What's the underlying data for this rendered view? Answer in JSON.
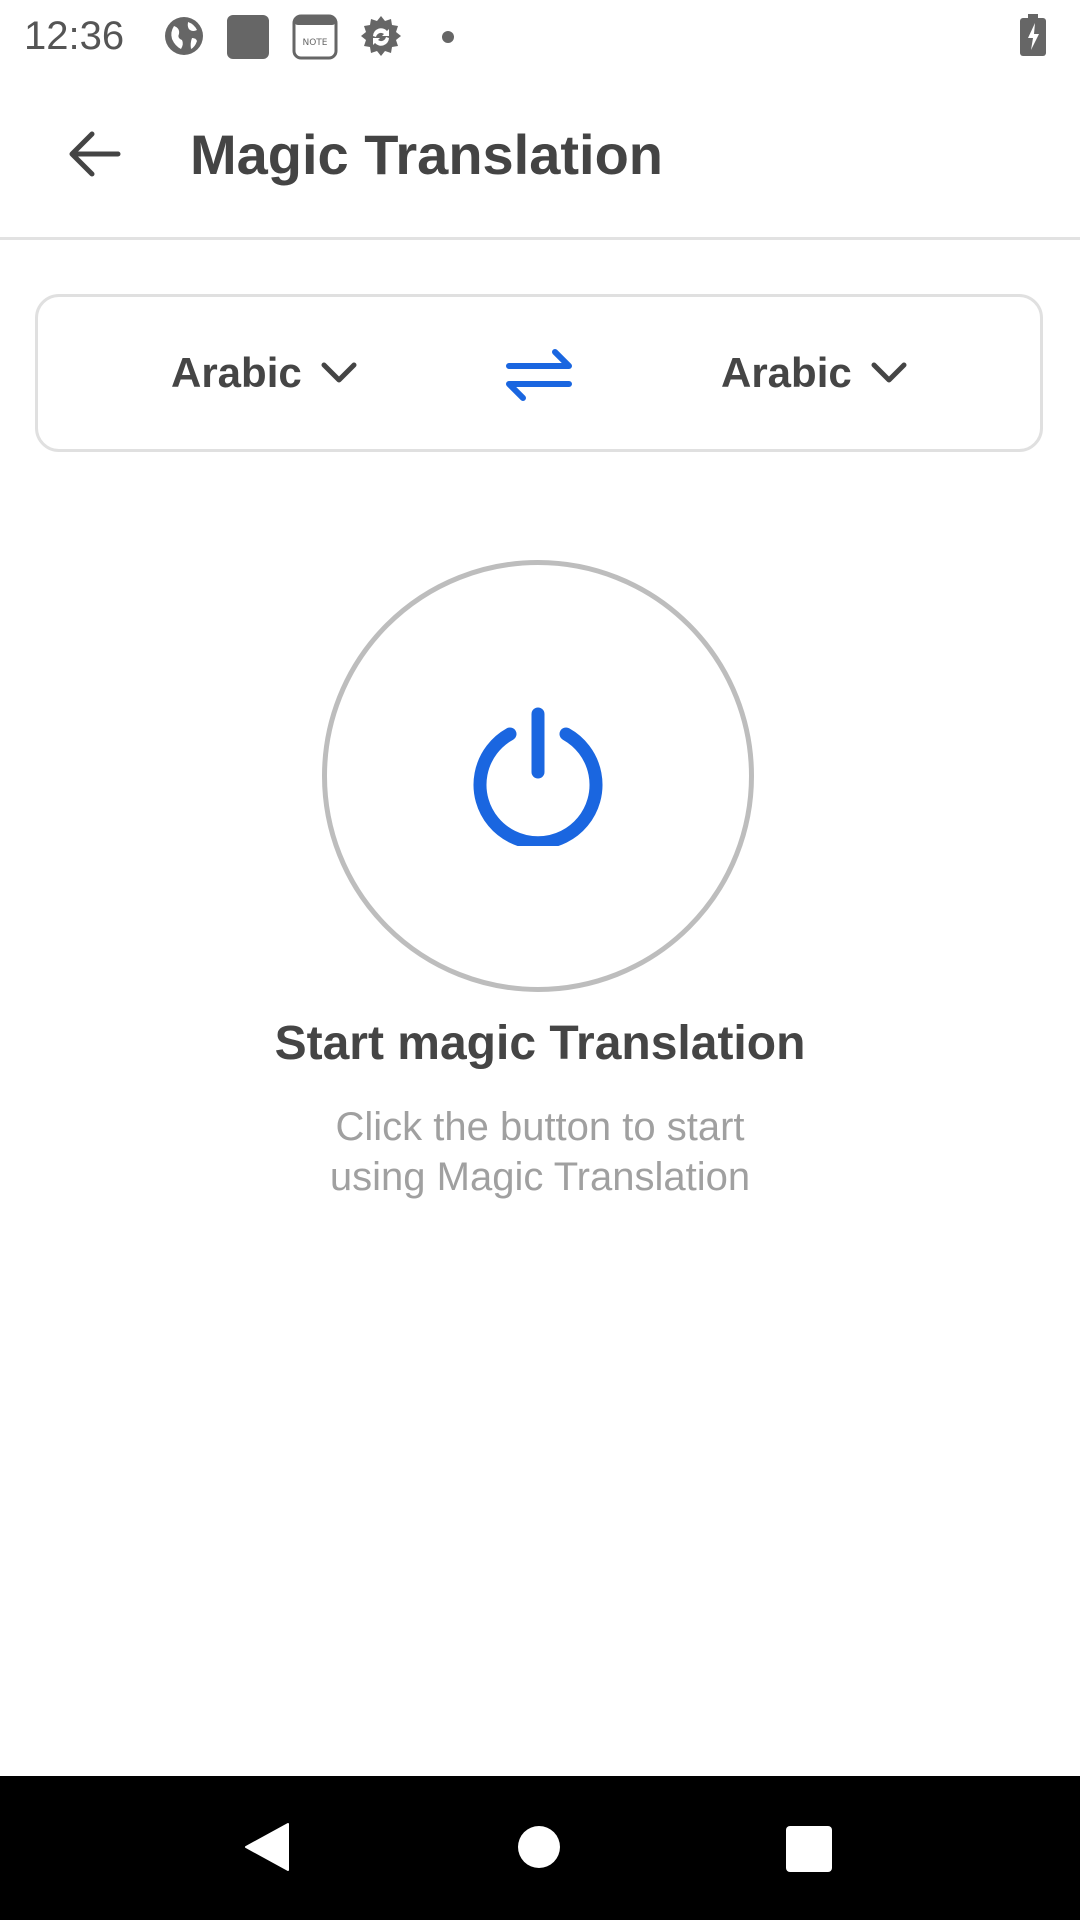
{
  "status_bar": {
    "time": "12:36",
    "icons": [
      "globe-icon",
      "app-square-icon",
      "note-icon",
      "sync-badge-icon",
      "dot-icon",
      "battery-charging-icon"
    ],
    "note_icon_text": "NOTE"
  },
  "app_bar": {
    "back_icon": "arrow-left-icon",
    "title": "Magic Translation"
  },
  "language_selector": {
    "source_language": "Arabic",
    "target_language": "Arabic",
    "swap_icon": "swap-arrows-icon",
    "dropdown_icon": "chevron-down-icon"
  },
  "main": {
    "power_icon": "power-icon",
    "title": "Start magic Translation",
    "subtitle_line1": "Click the button to start",
    "subtitle_line2": "using Magic Translation"
  },
  "colors": {
    "accent": "#1a66e0",
    "text_primary": "#454545",
    "text_secondary": "#a0a0a0",
    "border": "#e0e0e0",
    "circle_border": "#bdbdbd"
  },
  "nav_bar": {
    "icons": [
      "nav-back-icon",
      "nav-home-icon",
      "nav-recents-icon"
    ]
  }
}
